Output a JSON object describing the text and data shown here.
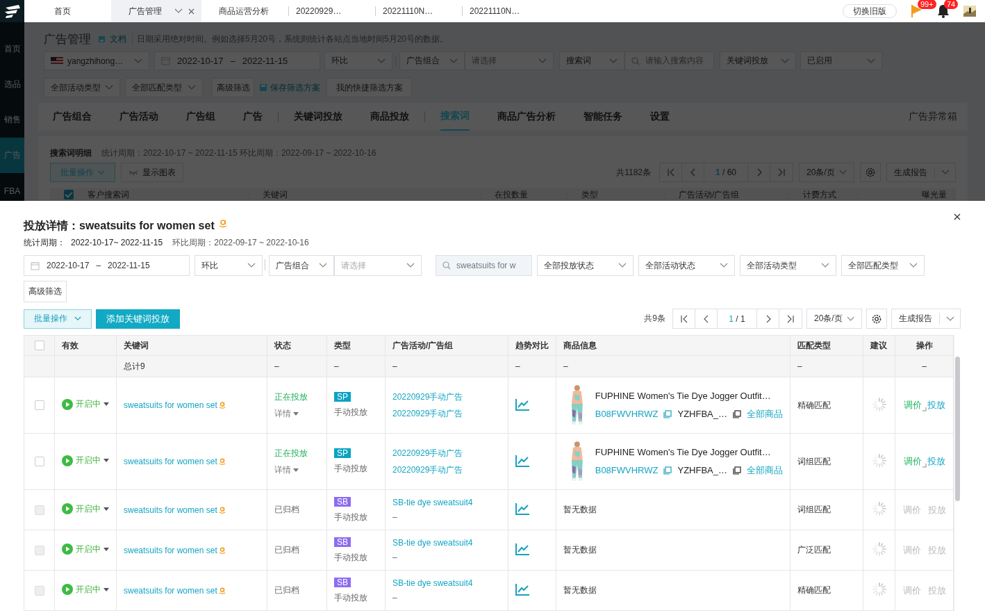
{
  "top_bar": {
    "tabs": [
      {
        "label": "首页",
        "selected": false,
        "closable": false
      },
      {
        "label": "广告管理",
        "selected": true,
        "closable": true
      },
      {
        "label": "商品运营分析",
        "selected": false,
        "closable": false
      },
      {
        "label": "20220929…",
        "selected": false,
        "closable": false
      },
      {
        "label": "20221110N…",
        "selected": false,
        "closable": false
      },
      {
        "label": "20221110N…",
        "selected": false,
        "closable": false
      }
    ],
    "switch_button": "切换旧版",
    "alerts": [
      {
        "kind": "flag",
        "badge": "99+"
      },
      {
        "kind": "bell",
        "badge": "74"
      }
    ]
  },
  "sidebar": {
    "items": [
      {
        "label": "首页",
        "selected": false
      },
      {
        "label": "选品",
        "selected": false
      },
      {
        "label": "销售",
        "selected": false
      },
      {
        "label": "广告",
        "selected": true
      },
      {
        "label": "FBA",
        "selected": false
      }
    ]
  },
  "page": {
    "title": "广告管理",
    "doc_link": "文档",
    "note": "日期采用绝对时间。例如选择5月20号，系统则统计各站点当地时间5月20号的数据。",
    "filters_row1": [
      {
        "kind": "account",
        "value": "yangzhihong…"
      },
      {
        "kind": "date",
        "start": "2022-10-17",
        "sep": "–",
        "end": "2022-11-15"
      },
      {
        "kind": "select",
        "value": "环比"
      },
      {
        "kind": "select",
        "value": "广告组合"
      },
      {
        "kind": "select",
        "placeholder": "请选择"
      },
      {
        "kind": "select",
        "value": "搜索词"
      },
      {
        "kind": "search",
        "placeholder": "请输入搜索内容"
      },
      {
        "kind": "select",
        "value": "关键词投放"
      },
      {
        "kind": "select",
        "value": "已启用"
      }
    ],
    "filters_row2": [
      {
        "kind": "select",
        "value": "全部活动类型"
      },
      {
        "kind": "select",
        "value": "全部匹配类型"
      },
      {
        "kind": "button",
        "value": "高级筛选"
      },
      {
        "kind": "link",
        "value": "保存筛选方案"
      },
      {
        "kind": "button",
        "value": "我的快捷筛选方案"
      }
    ],
    "tab_groups": [
      [
        {
          "label": "广告组合",
          "selected": false
        },
        {
          "label": "广告活动",
          "selected": false
        },
        {
          "label": "广告组",
          "selected": false
        },
        {
          "label": "广告",
          "selected": false
        }
      ],
      [
        {
          "label": "关键词投放",
          "selected": false
        },
        {
          "label": "商品投放",
          "selected": false
        }
      ],
      [
        {
          "label": "搜索词",
          "selected": true
        },
        {
          "label": "商品广告分析",
          "selected": false
        },
        {
          "label": "智能任务",
          "selected": false
        },
        {
          "label": "设置",
          "selected": false
        }
      ]
    ],
    "anomaly_link": "广告异常箱",
    "detail": {
      "title": "搜索词明细",
      "period": "统计周期：2022-10-17 ~ 2022-11-15 环比周期：2022-09-17 ~ 2022-10-16",
      "batch_button": "批量操作",
      "chart_button": "显示图表",
      "pager": {
        "total": "共1182条",
        "page": "1",
        "pages": "/ 60",
        "page_size": "20条/页",
        "report": "生成报告"
      }
    },
    "table_header": {
      "checked": true,
      "columns": [
        "客户搜索词",
        "关键词",
        "在投数量",
        "类型",
        "广告活动/广告组",
        "计费方式",
        "曝光量"
      ]
    }
  },
  "drawer": {
    "title": "投放详情：sweatsuits for women set",
    "period_label": "统计周期：",
    "period": "2022-10-17~ 2022-11-15",
    "compare": "环比周期：2022-09-17 ~ 2022-10-16",
    "filters": [
      {
        "kind": "date",
        "start": "2022-10-17",
        "sep": "–",
        "end": "2022-11-15"
      },
      {
        "kind": "select",
        "value": "环比"
      },
      {
        "kind": "select",
        "value": "广告组合"
      },
      {
        "kind": "select",
        "placeholder": "请选择"
      },
      {
        "kind": "search",
        "value": "sweatsuits for w",
        "disabled": true
      },
      {
        "kind": "select",
        "value": "全部投放状态"
      },
      {
        "kind": "select",
        "value": "全部活动状态"
      },
      {
        "kind": "select",
        "value": "全部活动类型"
      },
      {
        "kind": "select",
        "value": "全部匹配类型"
      }
    ],
    "advanced_button": "高级筛选",
    "batch_button": "批量操作",
    "add_button": "添加关键词投放",
    "pager": {
      "total": "共9条",
      "page": "1",
      "pages": "/ 1",
      "page_size": "20条/页",
      "report": "生成报告"
    },
    "header_checked": false,
    "columns": [
      "有效",
      "关键词",
      "状态",
      "类型",
      "广告活动/广告组",
      "趋势对比",
      "商品信息",
      "匹配类型",
      "建议",
      "操作"
    ],
    "total_row": {
      "label": "总计9",
      "cells": [
        "–",
        "–",
        "–",
        "–",
        "–",
        "–"
      ],
      "action": "–"
    },
    "rows": [
      {
        "checked": false,
        "disabled": false,
        "effect": "开启中",
        "keyword": "sweatsuits for women set",
        "state": {
          "kind": "active",
          "text": "正在投放",
          "detail": "详情"
        },
        "type": {
          "badge": "SP",
          "color": "#0aa3c2",
          "label": "手动投放"
        },
        "campaign": [
          {
            "text": "20220929手动广告",
            "link": true
          },
          {
            "text": "20220929手动广告",
            "link": true
          }
        ],
        "product": {
          "title": "FUPHINE Women's Tie Dye Jogger Outfit…",
          "asin": "B08FWVHRWZ",
          "sku": "YZHFBA_…",
          "all_link": "全部商品"
        },
        "match": "精确匹配",
        "actions": [
          {
            "label": "调价",
            "disabled": false
          },
          {
            "label": "投放",
            "disabled": false
          }
        ]
      },
      {
        "checked": false,
        "disabled": false,
        "effect": "开启中",
        "keyword": "sweatsuits for women set",
        "state": {
          "kind": "active",
          "text": "正在投放",
          "detail": "详情"
        },
        "type": {
          "badge": "SP",
          "color": "#0aa3c2",
          "label": "手动投放"
        },
        "campaign": [
          {
            "text": "20220929手动广告",
            "link": true
          },
          {
            "text": "20220929手动广告",
            "link": true
          }
        ],
        "product": {
          "title": "FUPHINE Women's Tie Dye Jogger Outfit…",
          "asin": "B08FWVHRWZ",
          "sku": "YZHFBA_…",
          "all_link": "全部商品"
        },
        "match": "词组匹配",
        "actions": [
          {
            "label": "调价",
            "disabled": false
          },
          {
            "label": "投放",
            "disabled": false
          }
        ]
      },
      {
        "checked": false,
        "disabled": true,
        "effect": "开启中",
        "keyword": "sweatsuits for women set",
        "state": {
          "kind": "archived",
          "text": "已归档"
        },
        "type": {
          "badge": "SB",
          "color": "#8e6cf2",
          "label": "手动投放"
        },
        "campaign": [
          {
            "text": "SB-tie dye sweatsuit4",
            "link": true
          },
          {
            "text": "–",
            "link": false
          }
        ],
        "no_data": "暂无数据",
        "match": "词组匹配",
        "actions": [
          {
            "label": "调价",
            "disabled": true
          },
          {
            "label": "投放",
            "disabled": true
          }
        ]
      },
      {
        "checked": false,
        "disabled": true,
        "effect": "开启中",
        "keyword": "sweatsuits for women set",
        "state": {
          "kind": "archived",
          "text": "已归档"
        },
        "type": {
          "badge": "SB",
          "color": "#8e6cf2",
          "label": "手动投放"
        },
        "campaign": [
          {
            "text": "SB-tie dye sweatsuit4",
            "link": true
          },
          {
            "text": "–",
            "link": false
          }
        ],
        "no_data": "暂无数据",
        "match": "广泛匹配",
        "actions": [
          {
            "label": "调价",
            "disabled": true
          },
          {
            "label": "投放",
            "disabled": true
          }
        ]
      },
      {
        "checked": false,
        "disabled": true,
        "effect": "开启中",
        "keyword": "sweatsuits for women set",
        "state": {
          "kind": "archived",
          "text": "已归档"
        },
        "type": {
          "badge": "SB",
          "color": "#8e6cf2",
          "label": "手动投放"
        },
        "campaign": [
          {
            "text": "SB-tie dye sweatsuit4",
            "link": true
          },
          {
            "text": "–",
            "link": false
          }
        ],
        "no_data": "暂无数据",
        "match": "精确匹配",
        "actions": [
          {
            "label": "调价",
            "disabled": true
          },
          {
            "label": "投放",
            "disabled": true
          }
        ]
      }
    ]
  }
}
